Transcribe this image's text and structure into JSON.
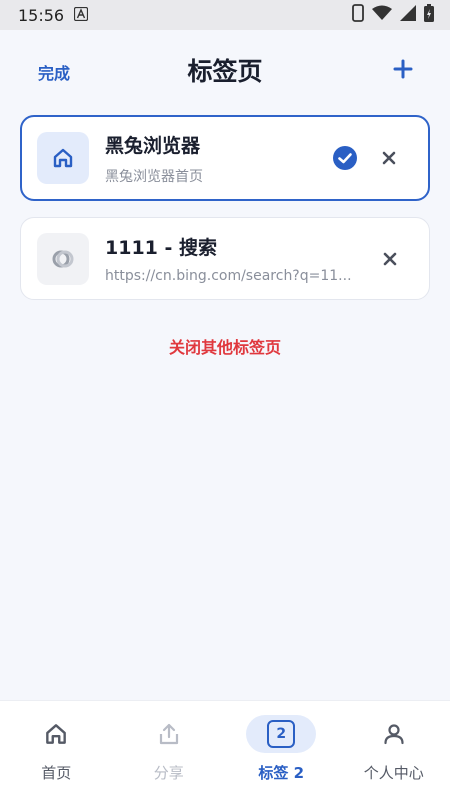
{
  "status_bar": {
    "time": "15:56"
  },
  "header": {
    "done_label": "完成",
    "title": "标签页"
  },
  "tabs": [
    {
      "title": "黑兔浏览器",
      "subtitle": "黑兔浏览器首页",
      "icon": "home-icon",
      "active": true
    },
    {
      "title": "1111 - 搜索",
      "subtitle": "https://cn.bing.com/search?q=11...",
      "icon": "bing-icon",
      "active": false
    }
  ],
  "close_others_label": "关闭其他标签页",
  "bottom_nav": {
    "items": [
      {
        "label": "首页",
        "icon": "home-icon"
      },
      {
        "label": "分享",
        "icon": "share-icon"
      },
      {
        "label": "标签 2",
        "icon": "tabs-icon",
        "count": "2"
      },
      {
        "label": "个人中心",
        "icon": "person-icon"
      }
    ]
  },
  "colors": {
    "accent": "#2a5fc4",
    "danger": "#e0383e",
    "background": "#f5f7fc"
  }
}
